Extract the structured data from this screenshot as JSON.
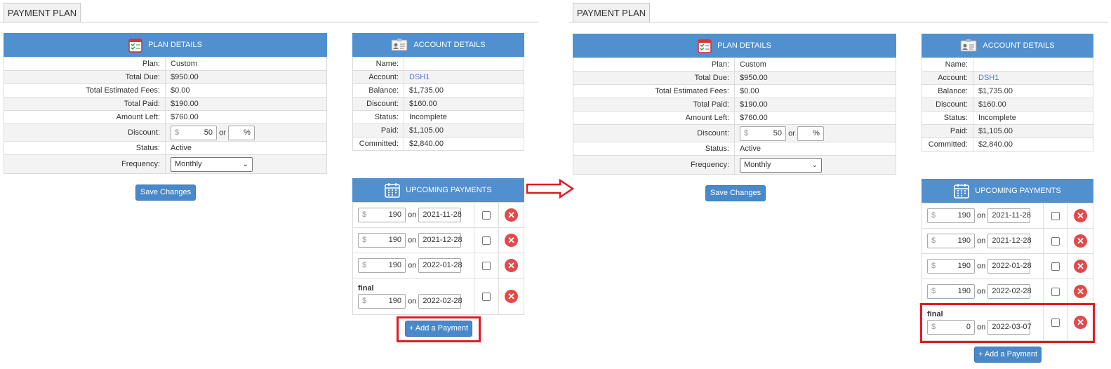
{
  "panels": [
    {
      "tab": "PAYMENT PLAN",
      "plan": {
        "title": "PLAN DETAILS",
        "rows": [
          {
            "label": "Plan:",
            "value": "Custom"
          },
          {
            "label": "Total Due:",
            "value": "$950.00"
          },
          {
            "label": "Total Estimated Fees:",
            "value": "$0.00"
          },
          {
            "label": "Total Paid:",
            "value": "$190.00"
          },
          {
            "label": "Amount Left:",
            "value": "$760.00"
          }
        ],
        "discount_label": "Discount:",
        "discount_currency": "$",
        "discount_value": "50",
        "or_text": "or",
        "percent_sign": "%",
        "status_label": "Status:",
        "status_value": "Active",
        "frequency_label": "Frequency:",
        "frequency_value": "Monthly"
      },
      "save_button": "Save Changes",
      "account": {
        "title": "ACCOUNT DETAILS",
        "rows": [
          {
            "label": "Name:",
            "value": ""
          },
          {
            "label": "Account:",
            "value": "DSH1"
          },
          {
            "label": "Balance:",
            "value": "$1,735.00"
          },
          {
            "label": "Discount:",
            "value": "$160.00"
          },
          {
            "label": "Status:",
            "value": "Incomplete"
          },
          {
            "label": "Paid:",
            "value": "$1,105.00"
          },
          {
            "label": "Committed:",
            "value": "$2,840.00"
          }
        ]
      },
      "upcoming": {
        "title": "UPCOMING PAYMENTS",
        "payments": [
          {
            "label": "",
            "currency": "$",
            "amount": "190",
            "on": "on",
            "date": "2021-11-28"
          },
          {
            "label": "",
            "currency": "$",
            "amount": "190",
            "on": "on",
            "date": "2021-12-28"
          },
          {
            "label": "",
            "currency": "$",
            "amount": "190",
            "on": "on",
            "date": "2022-01-28"
          },
          {
            "label": "final",
            "currency": "$",
            "amount": "190",
            "on": "on",
            "date": "2022-02-28"
          }
        ]
      },
      "add_button": "+ Add a Payment"
    },
    {
      "tab": "PAYMENT PLAN",
      "plan": {
        "title": "PLAN DETAILS",
        "rows": [
          {
            "label": "Plan:",
            "value": "Custom"
          },
          {
            "label": "Total Due:",
            "value": "$950.00"
          },
          {
            "label": "Total Estimated Fees:",
            "value": "$0.00"
          },
          {
            "label": "Total Paid:",
            "value": "$190.00"
          },
          {
            "label": "Amount Left:",
            "value": "$760.00"
          }
        ],
        "discount_label": "Discount:",
        "discount_currency": "$",
        "discount_value": "50",
        "or_text": "or",
        "percent_sign": "%",
        "status_label": "Status:",
        "status_value": "Active",
        "frequency_label": "Frequency:",
        "frequency_value": "Monthly"
      },
      "save_button": "Save Changes",
      "account": {
        "title": "ACCOUNT DETAILS",
        "rows": [
          {
            "label": "Name:",
            "value": ""
          },
          {
            "label": "Account:",
            "value": "DSH1"
          },
          {
            "label": "Balance:",
            "value": "$1,735.00"
          },
          {
            "label": "Discount:",
            "value": "$160.00"
          },
          {
            "label": "Status:",
            "value": "Incomplete"
          },
          {
            "label": "Paid:",
            "value": "$1,105.00"
          },
          {
            "label": "Committed:",
            "value": "$2,840.00"
          }
        ]
      },
      "upcoming": {
        "title": "UPCOMING PAYMENTS",
        "payments": [
          {
            "label": "",
            "currency": "$",
            "amount": "190",
            "on": "on",
            "date": "2021-11-28"
          },
          {
            "label": "",
            "currency": "$",
            "amount": "190",
            "on": "on",
            "date": "2021-12-28"
          },
          {
            "label": "",
            "currency": "$",
            "amount": "190",
            "on": "on",
            "date": "2022-01-28"
          },
          {
            "label": "",
            "currency": "$",
            "amount": "190",
            "on": "on",
            "date": "2022-02-28"
          },
          {
            "label": "final",
            "currency": "$",
            "amount": "0",
            "on": "on",
            "date": "2022-03-07"
          }
        ]
      },
      "add_button": "+ Add a Payment"
    }
  ],
  "colors": {
    "header": "#5190cf",
    "button": "#4a89c9",
    "highlight": "#e01b24",
    "delete": "#e04a4a",
    "link": "#4f7fbf"
  }
}
